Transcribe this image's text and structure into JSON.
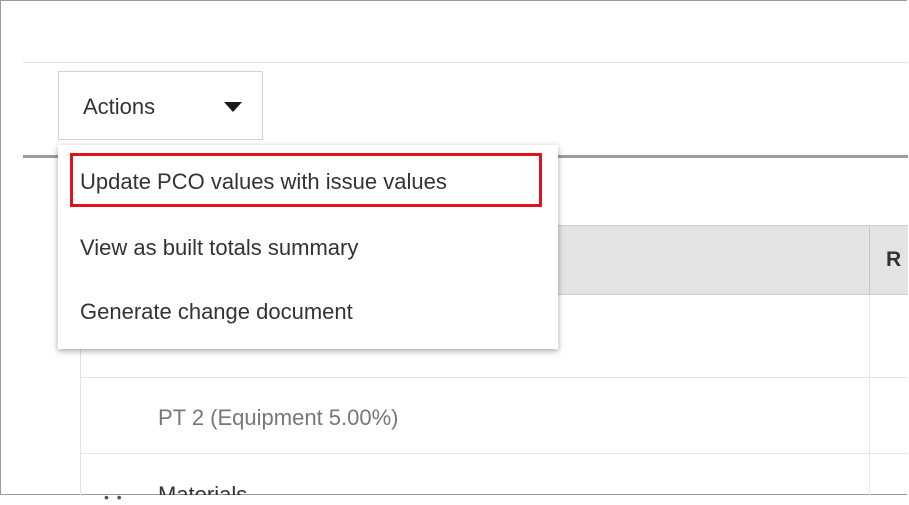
{
  "toolbar": {
    "actions_label": "Actions"
  },
  "actions_menu": {
    "items": [
      {
        "label": "Update PCO values with issue values",
        "highlighted": true
      },
      {
        "label": "View as built totals summary"
      },
      {
        "label": "Generate change document"
      }
    ],
    "highlight_color": "#e0121b"
  },
  "table": {
    "header_right": "R",
    "rows": [
      {
        "label": "PT 2 (Equipment 5.00%)"
      },
      {
        "label": "Materials"
      }
    ]
  }
}
